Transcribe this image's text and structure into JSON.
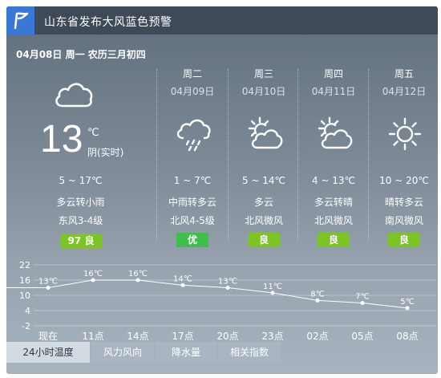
{
  "alert": {
    "title": "山东省发布大风蓝色预警"
  },
  "date_line": "04月08日 周一 农历三月初四",
  "today": {
    "temp": "13",
    "unit": "℃",
    "condition_now": "阴(实时)",
    "range": "5 ~ 17℃",
    "weather": "多云转小雨",
    "wind": "东风3-4级",
    "aqi_value": "97",
    "aqi_label": "良",
    "icon": "cloud-icon"
  },
  "forecast": [
    {
      "day": "周二",
      "date": "04月09日",
      "range": "1 ~ 7℃",
      "weather": "中雨转多云",
      "wind": "北风4-5级",
      "aqi": "优",
      "icon": "rain-cloud-icon"
    },
    {
      "day": "周三",
      "date": "04月10日",
      "range": "5 ~ 14℃",
      "weather": "多云",
      "wind": "北风微风",
      "aqi": "良",
      "icon": "sun-cloud-icon"
    },
    {
      "day": "周四",
      "date": "04月11日",
      "range": "4 ~ 13℃",
      "weather": "多云转晴",
      "wind": "北风微风",
      "aqi": "良",
      "icon": "sun-cloud-icon"
    },
    {
      "day": "周五",
      "date": "04月12日",
      "range": "10 ~ 20℃",
      "weather": "晴转多云",
      "wind": "南风微风",
      "aqi": "良",
      "icon": "sun-icon"
    }
  ],
  "colors": {
    "aqi_green": "#7cc424",
    "alert_blue": "#3a78d8"
  },
  "chart_data": {
    "type": "line",
    "categories": [
      "现在",
      "11点",
      "14点",
      "17点",
      "20点",
      "23点",
      "02点",
      "05点",
      "08点"
    ],
    "values": [
      13,
      16,
      16,
      14,
      13,
      11,
      8,
      7,
      5
    ],
    "point_labels": [
      "13℃",
      "16℃",
      "16℃",
      "14℃",
      "13℃",
      "11℃",
      "8℃",
      "7℃",
      "5℃"
    ],
    "yticks": [
      "22",
      "16",
      "10",
      "4",
      "-2"
    ],
    "ylim": [
      -2,
      22
    ],
    "grid": true
  },
  "tabs": [
    {
      "label": "24小时温度",
      "active": true
    },
    {
      "label": "风力风向",
      "active": false
    },
    {
      "label": "降水量",
      "active": false
    },
    {
      "label": "相关指数",
      "active": false
    }
  ]
}
